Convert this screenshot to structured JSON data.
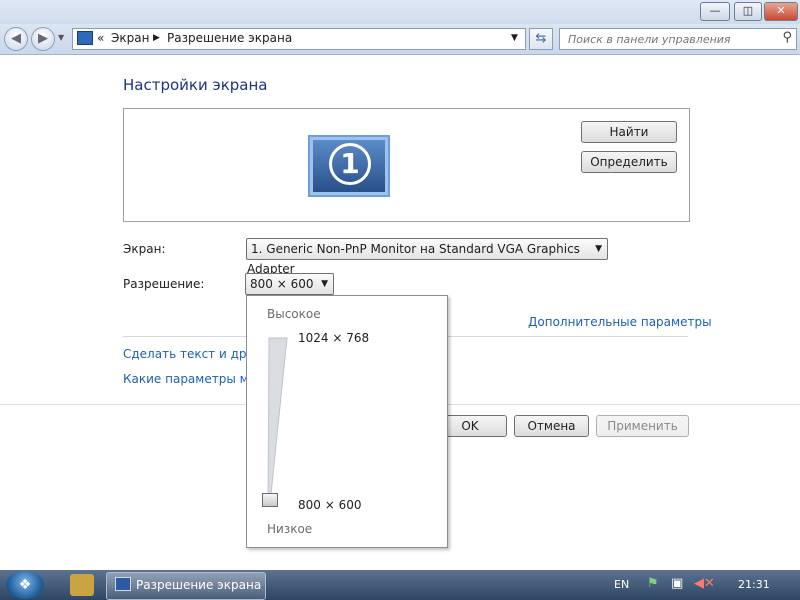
{
  "window": {
    "minimize_label": "—",
    "maximize_label": "◫",
    "close_label": "✕"
  },
  "nav": {
    "back_icon": "back-arrow-icon",
    "forward_icon": "forward-arrow-icon",
    "overflow": "«",
    "breadcrumb": [
      "Экран",
      "Разрешение экрана"
    ],
    "search_placeholder": "Поиск в панели управления"
  },
  "page": {
    "title": "Настройки экрана",
    "monitor_number": "1",
    "find_button": "Найти",
    "identify_button": "Определить",
    "display_label": "Экран:",
    "display_value": "1. Generic Non-PnP Monitor на Standard VGA Graphics Adapter",
    "resolution_label": "Разрешение:",
    "resolution_value": "800 × 600",
    "advanced_link": "Дополнительные параметры",
    "link_text_size": "Сделать текст и другие",
    "link_which_params": "Какие параметры мон",
    "ok_button": "OK",
    "cancel_button": "Отмена",
    "apply_button": "Применить"
  },
  "resolution_popup": {
    "high_label": "Высокое",
    "low_label": "Низкое",
    "top_value": "1024 × 768",
    "bottom_value": "800 × 600",
    "slider_position": 0
  },
  "taskbar": {
    "active_item": "Разрешение экрана",
    "language": "EN",
    "clock": "21:31"
  }
}
